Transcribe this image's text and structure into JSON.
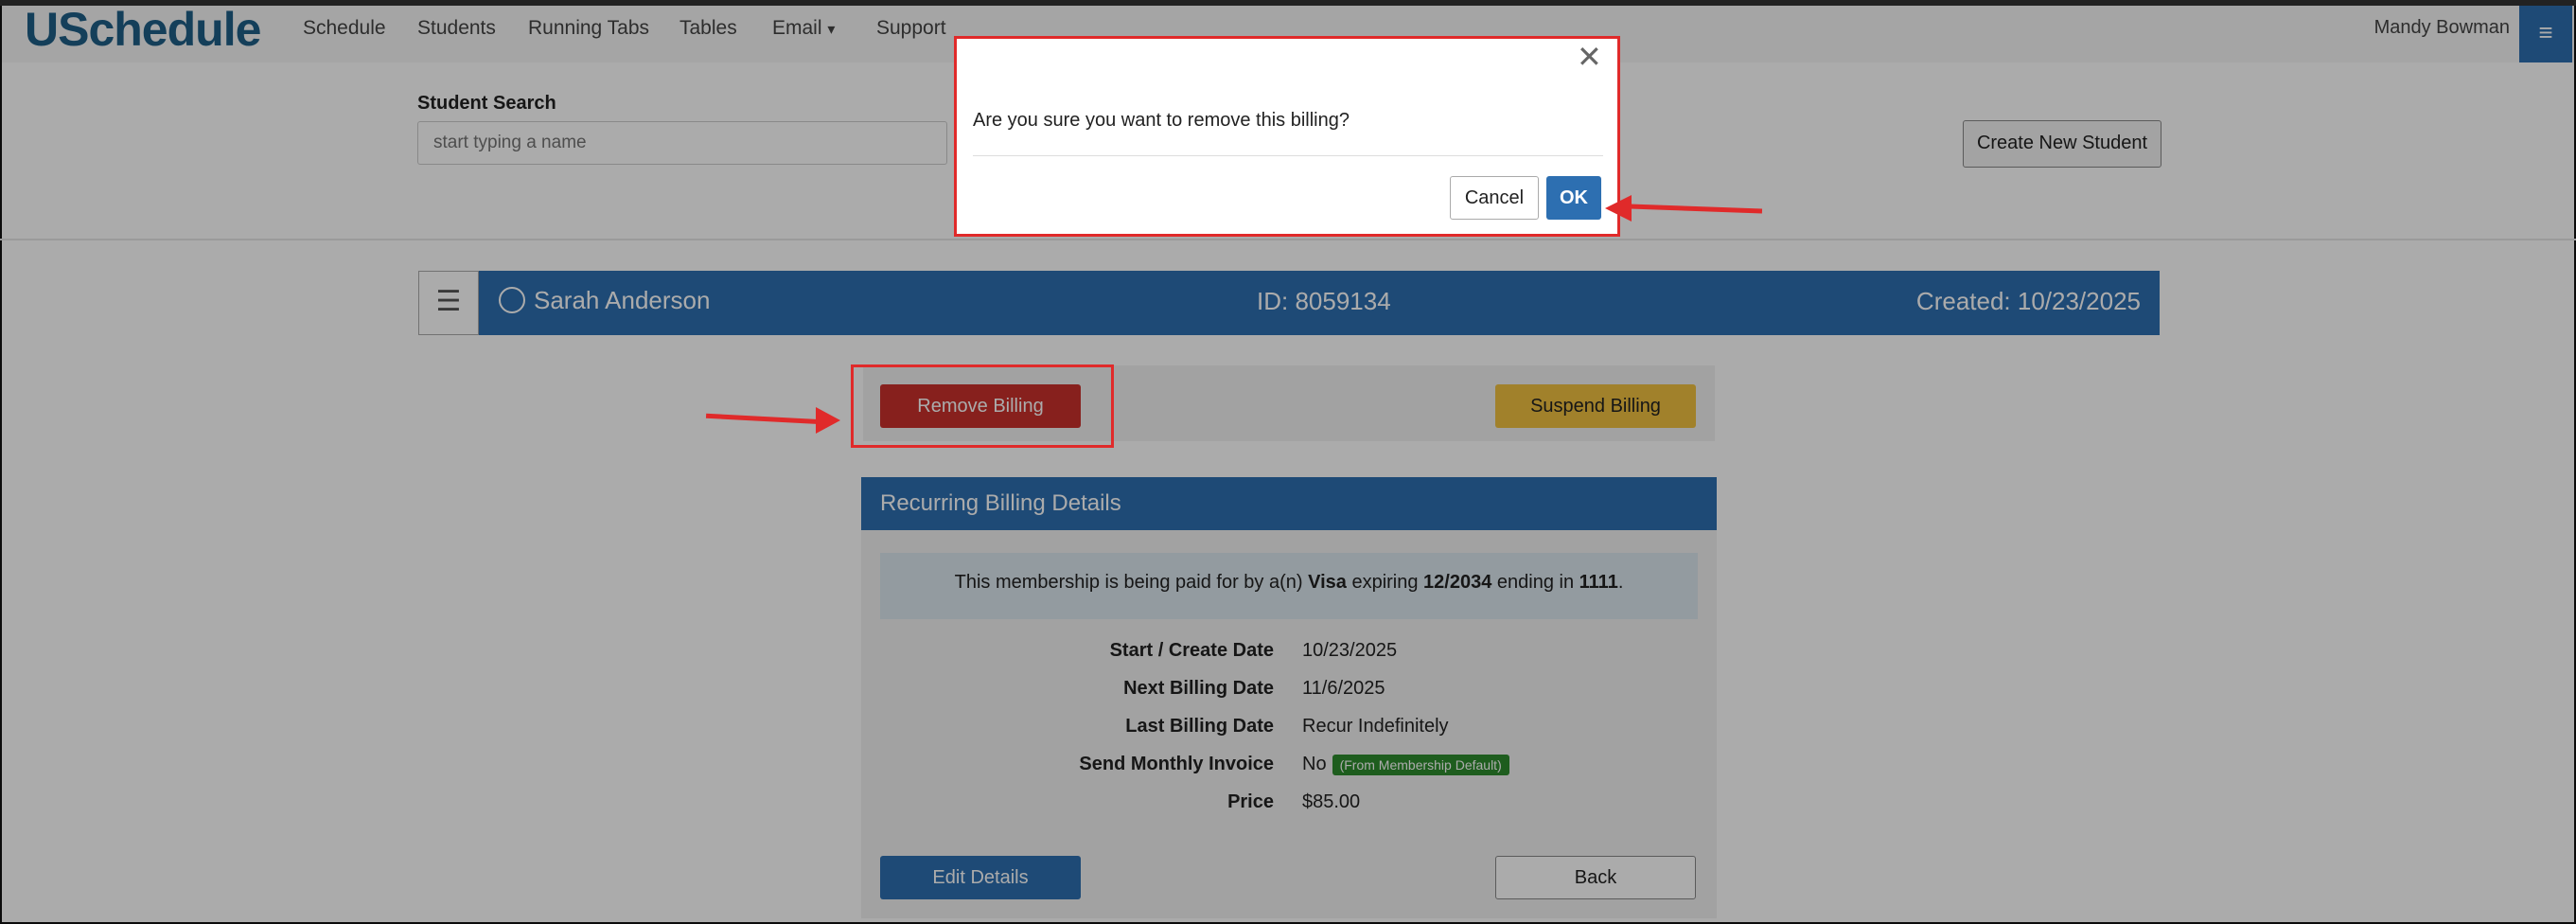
{
  "navbar": {
    "brand": "USchedule",
    "items": [
      "Schedule",
      "Students",
      "Running Tabs",
      "Tables",
      "Email",
      "Support"
    ],
    "email_caret": "▾",
    "user": "Mandy Bowman",
    "menu_glyph": "≡"
  },
  "search": {
    "label": "Student Search",
    "placeholder": "start typing a name",
    "create_button": "Create New Student"
  },
  "student": {
    "menu_glyph": "☰",
    "name": "Sarah Anderson",
    "id": "ID: 8059134",
    "created": "Created: 10/23/2025"
  },
  "actions": {
    "remove": "Remove Billing",
    "suspend": "Suspend Billing"
  },
  "details": {
    "title": "Recurring Billing Details",
    "alert": {
      "prefix": "This membership is being paid for by a(n) ",
      "card": "Visa",
      "mid1": " expiring ",
      "expiry": "12/2034",
      "mid2": " ending in ",
      "last4": "1111",
      "suffix": "."
    },
    "rows": [
      {
        "label": "Start / Create Date",
        "value": "10/23/2025"
      },
      {
        "label": "Next Billing Date",
        "value": "11/6/2025"
      },
      {
        "label": "Last Billing Date",
        "value": "Recur Indefinitely"
      },
      {
        "label": "Send Monthly Invoice",
        "value": "No",
        "badge": "(From Membership Default)"
      },
      {
        "label": "Price",
        "value": "$85.00"
      }
    ],
    "edit": "Edit Details",
    "back": "Back"
  },
  "modal": {
    "message": "Are you sure you want to remove this billing?",
    "close_glyph": "✕",
    "cancel": "Cancel",
    "ok": "OK"
  },
  "colors": {
    "primary": "#2d6fb1",
    "danger": "#c9302c",
    "warning": "#f0c040",
    "success": "#2e8b2e",
    "annotation": "#e02a2a"
  }
}
